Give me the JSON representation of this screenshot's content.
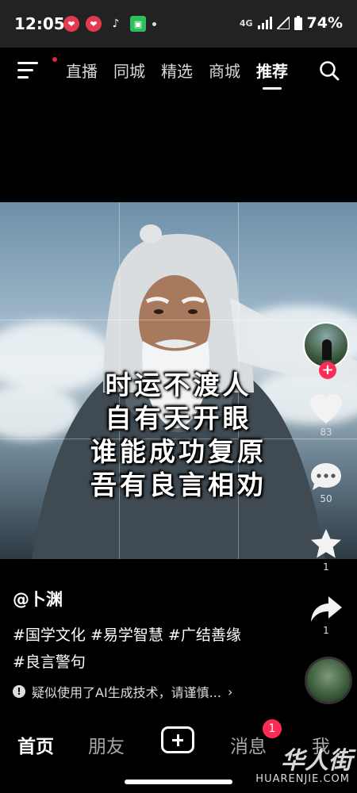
{
  "status_bar": {
    "time": "12:05",
    "network": "4G",
    "battery": "74%",
    "app_icons": [
      "heart-app-icon",
      "heart-app-icon",
      "tiktok-icon",
      "green-app-icon"
    ]
  },
  "top_nav": {
    "tabs": [
      {
        "label": "直播"
      },
      {
        "label": "同城"
      },
      {
        "label": "精选"
      },
      {
        "label": "商城"
      },
      {
        "label": "推荐",
        "active": true
      }
    ]
  },
  "video": {
    "poem_lines": [
      "时运不渡人",
      "自有天开眼",
      "谁能成功复原",
      "吾有良言相劝"
    ]
  },
  "side_actions": {
    "follow_symbol": "+",
    "like_count": "83",
    "comment_count": "50",
    "favorite_count": "1",
    "share_count": "1"
  },
  "post": {
    "author": "@卜渊",
    "tags_line1": "#国学文化 #易学智慧 #广结善缘",
    "tags_line2": "#良言警句",
    "ai_notice": "疑似使用了AI生成技术，请谨慎...",
    "ai_notice_arrow": "›"
  },
  "bottom_nav": {
    "home": "首页",
    "friends": "朋友",
    "messages": "消息",
    "messages_badge": "1",
    "me": "我"
  },
  "watermark": {
    "logo": "华人街",
    "text": "HUARENJIE.COM"
  },
  "colors": {
    "accent": "#fe2c55",
    "background": "#000000",
    "status_bar": "#222222"
  }
}
